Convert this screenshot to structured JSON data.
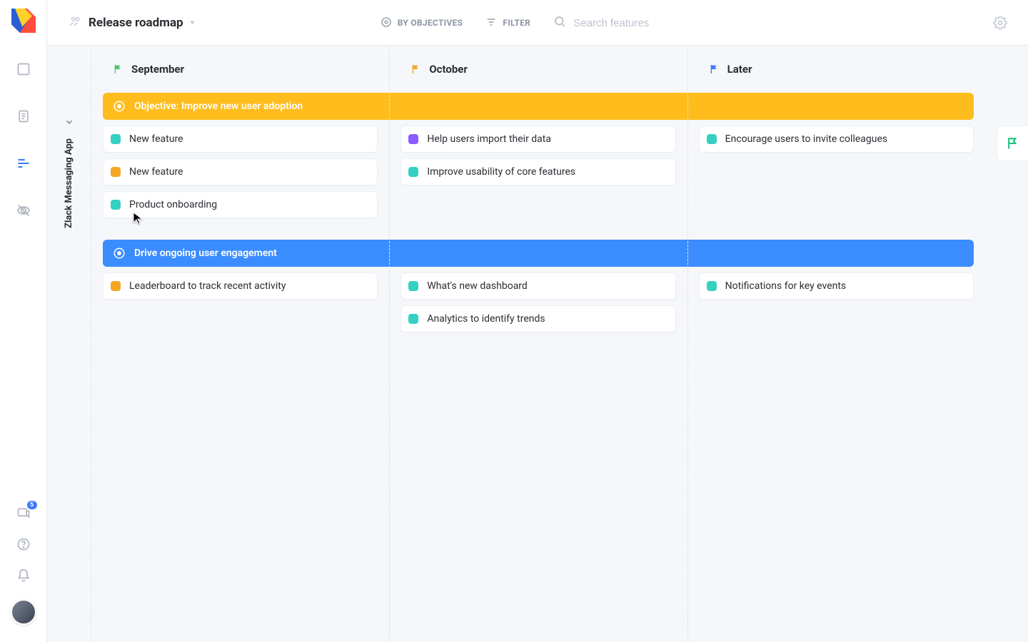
{
  "colors": {
    "accent_blue": "#3e7bfa",
    "green_flag": "#4fc36a",
    "orange_flag": "#f5a623",
    "blue_flag": "#3e7bfa",
    "swatch_teal": "#35d0c2",
    "swatch_orange": "#f5a623",
    "swatch_purple": "#8c5bff",
    "band_yellow": "#febd1d",
    "band_blue": "#3b8cff",
    "flag_tab_green": "#1dc27a"
  },
  "rail": {
    "badge": "5"
  },
  "header": {
    "board_title": "Release roadmap",
    "group_label": "BY OBJECTIVES",
    "filter_label": "FILTER",
    "search_placeholder": "Search features"
  },
  "vertical_pane": {
    "label": "Zlack Messaging App"
  },
  "columns": [
    {
      "title": "September",
      "flag_color": "green_flag"
    },
    {
      "title": "October",
      "flag_color": "orange_flag"
    },
    {
      "title": "Later",
      "flag_color": "blue_flag"
    }
  ],
  "swimlanes": [
    {
      "label": "Objective: Improve new user adoption",
      "band_color": "band_yellow",
      "cards": [
        [
          {
            "title": "New feature",
            "swatch": "swatch_teal"
          },
          {
            "title": "New feature",
            "swatch": "swatch_orange"
          },
          {
            "title": "Product onboarding",
            "swatch": "swatch_teal"
          }
        ],
        [
          {
            "title": "Help users import their data",
            "swatch": "swatch_purple"
          },
          {
            "title": "Improve usability of core features",
            "swatch": "swatch_teal"
          }
        ],
        [
          {
            "title": "Encourage users to invite colleagues",
            "swatch": "swatch_teal"
          }
        ]
      ]
    },
    {
      "label": "Drive ongoing user engagement",
      "band_color": "band_blue",
      "cards": [
        [
          {
            "title": "Leaderboard to track recent activity",
            "swatch": "swatch_orange"
          }
        ],
        [
          {
            "title": "What's new dashboard",
            "swatch": "swatch_teal"
          },
          {
            "title": "Analytics to identify trends",
            "swatch": "swatch_teal"
          }
        ],
        [
          {
            "title": "Notifications for key events",
            "swatch": "swatch_teal"
          }
        ]
      ]
    }
  ]
}
